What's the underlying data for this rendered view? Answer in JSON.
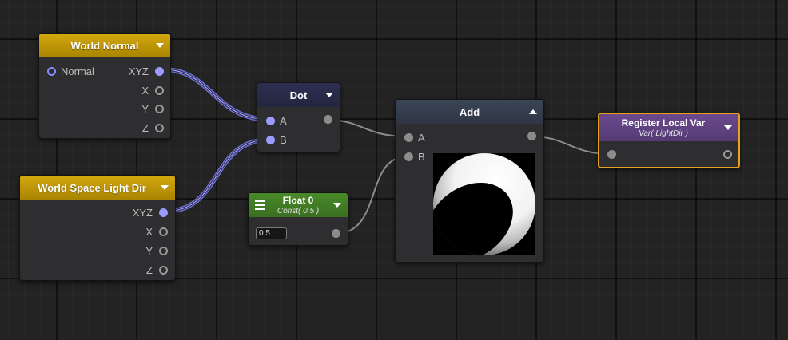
{
  "nodes": {
    "world_normal": {
      "title": "World Normal",
      "input_label": "Normal",
      "outputs": [
        "XYZ",
        "X",
        "Y",
        "Z"
      ]
    },
    "light_dir": {
      "title": "World Space Light Dir",
      "outputs": [
        "XYZ",
        "X",
        "Y",
        "Z"
      ]
    },
    "dot": {
      "title": "Dot",
      "inputs": [
        "A",
        "B"
      ]
    },
    "float": {
      "title": "Float 0",
      "subtitle": "Const( 0.5 )",
      "value": "0.5"
    },
    "add": {
      "title": "Add",
      "inputs": [
        "A",
        "B"
      ]
    },
    "register": {
      "title": "Register Local Var",
      "subtitle": "Var( LightDir )"
    }
  },
  "colors": {
    "vector_wire": "#9b9bff",
    "scalar_wire": "#8c8c8c",
    "selected_border": "#e8a11a"
  }
}
